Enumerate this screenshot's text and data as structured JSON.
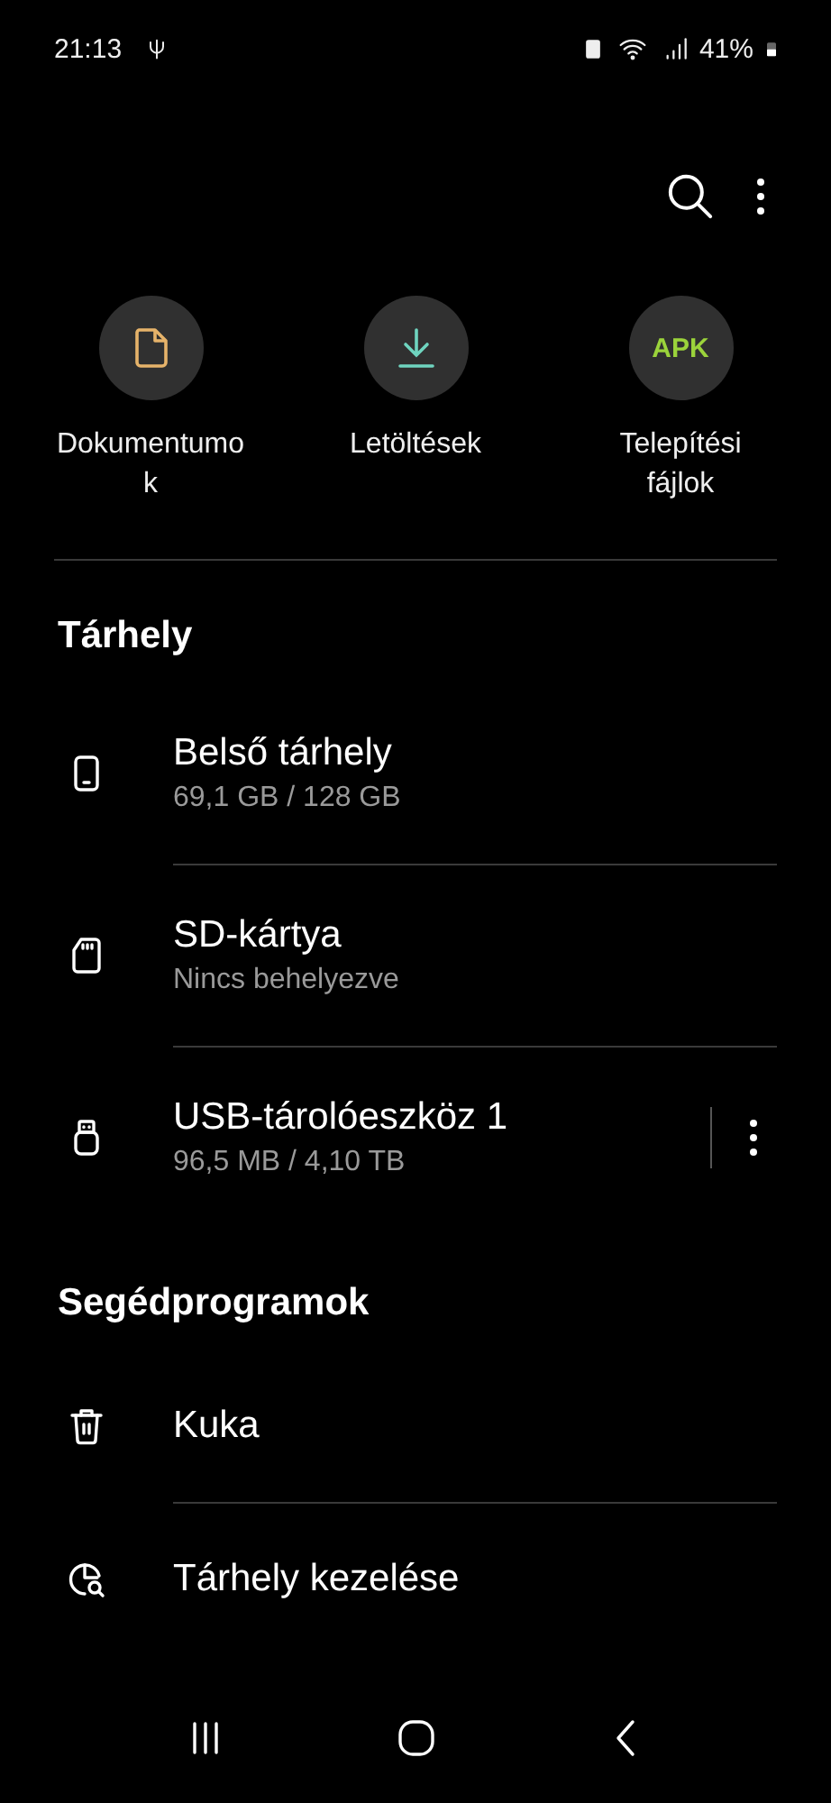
{
  "status_bar": {
    "time": "21:13",
    "battery_text": "41%"
  },
  "shortcuts": [
    {
      "kind": "document",
      "label": "Dokumentumok"
    },
    {
      "kind": "download",
      "label": "Letöltések"
    },
    {
      "kind": "apk",
      "label": "Telepítési fájlok",
      "badge": "APK"
    }
  ],
  "storage": {
    "title": "Tárhely",
    "items": [
      {
        "kind": "phone",
        "name": "Belső tárhely",
        "detail": "69,1 GB / 128 GB",
        "more": false
      },
      {
        "kind": "sd",
        "name": "SD-kártya",
        "detail": "Nincs behelyezve",
        "more": false
      },
      {
        "kind": "usb",
        "name": "USB-tárolóeszköz 1",
        "detail": "96,5 MB / 4,10 TB",
        "more": true
      }
    ]
  },
  "utilities": {
    "title": "Segédprogramok",
    "items": [
      {
        "kind": "trash",
        "name": "Kuka"
      },
      {
        "kind": "analyze",
        "name": "Tárhely kezelése"
      }
    ]
  }
}
